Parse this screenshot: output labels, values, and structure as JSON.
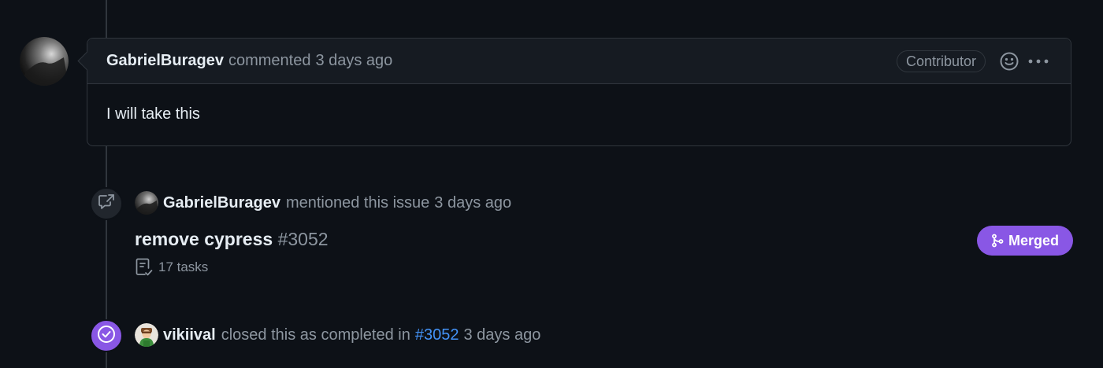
{
  "comment": {
    "author": "GabrielBuragev",
    "action": "commented",
    "time": "3 days ago",
    "badge": "Contributor",
    "body": "I will take this",
    "icons": [
      "smiley-icon",
      "kebab-horizontal-icon"
    ]
  },
  "mention_event": {
    "icon": "cross-reference-icon",
    "author": "GabrielBuragev",
    "action": "mentioned this issue",
    "time": "3 days ago",
    "ref_title": "remove cypress",
    "ref_number": "#3052",
    "tasks_label": "17 tasks",
    "status_label": "Merged",
    "status_color": "#8957e5"
  },
  "closed_event": {
    "icon": "check-circle-icon",
    "author": "vikiival",
    "action": "closed this as completed in",
    "ref_link": "#3052",
    "time": "3 days ago",
    "badge_color": "#8957e5"
  },
  "colors": {
    "background": "#0d1117",
    "header_bg": "#161b22",
    "border": "#30363d",
    "muted_text": "#8d96a0",
    "link": "#4493f8"
  }
}
